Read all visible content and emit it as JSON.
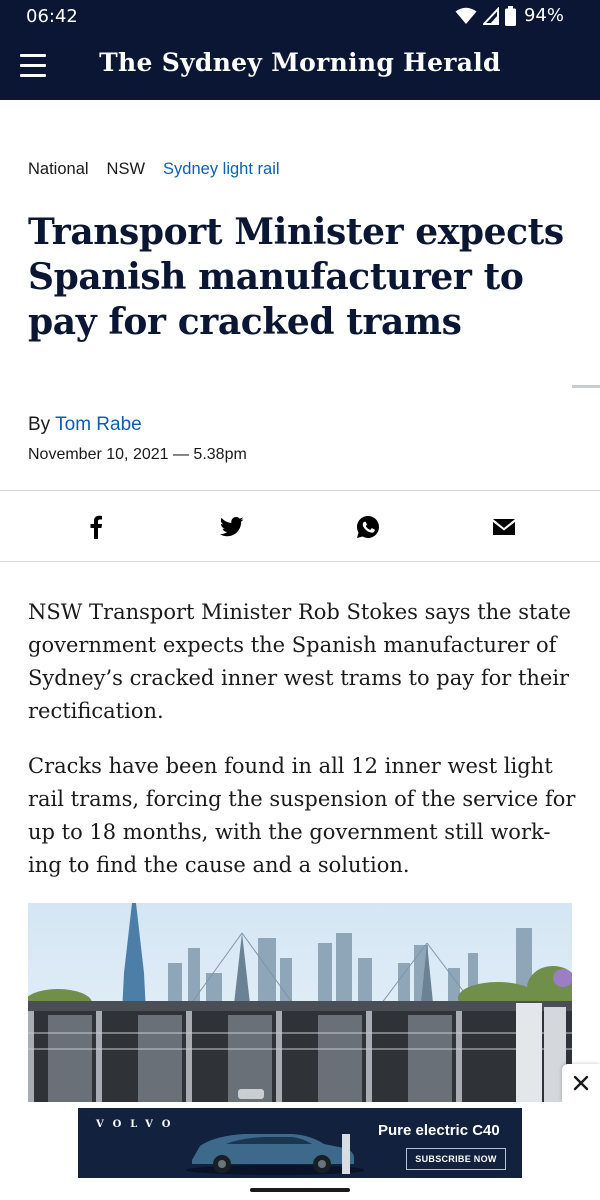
{
  "status_bar": {
    "time": "06:42",
    "battery": "94%"
  },
  "header": {
    "masthead": "The Sydney Morning Herald"
  },
  "breadcrumb": [
    "National",
    "NSW",
    "Sydney light rail"
  ],
  "article": {
    "headline": "Transport Minister expects Spanish manufacturer to pay for cracked trams",
    "byline_prefix": "By",
    "author": "Tom Rabe",
    "dateline": "November 10, 2021 — 5.38pm",
    "paragraphs": [
      "NSW Transport Minister Rob Stokes says the state government expects the Spanish manufacturer of Sydney’s cracked inner west trams to pay for their rectification.",
      "Cracks have been found in all 12 inner west light rail trams, forcing the suspension of the service for up to 18 months, with the government still work-ing to find the cause and a solution."
    ]
  },
  "share": [
    "facebook-icon",
    "twitter-icon",
    "whatsapp-icon",
    "email-icon"
  ],
  "ad": {
    "brand": "VOLVO",
    "headline": "Pure electric C40",
    "cta": "SUBSCRIBE NOW"
  },
  "colors": {
    "navy": "#0a1633",
    "link": "#0a5fb4"
  }
}
